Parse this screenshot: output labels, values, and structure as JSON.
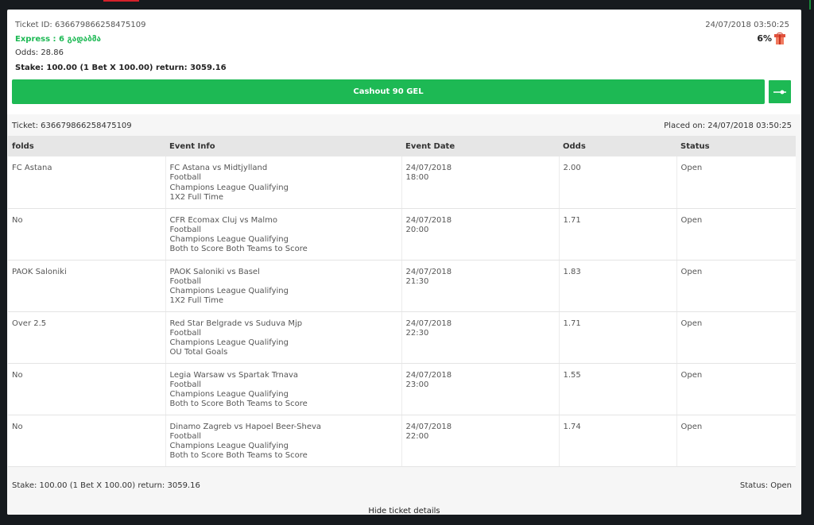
{
  "ticket": {
    "id_label": "Ticket ID: 636679866258475109",
    "date": "24/07/2018 03:50:25",
    "express": "Express : 6 გადაბმა",
    "odds": "Odds: 28.86",
    "bonus_percent": "6%",
    "stake_summary": "Stake: 100.00 (1 Bet X 100.00)  return: 3059.16"
  },
  "cashout": {
    "label": "Cashout 90 GEL"
  },
  "details": {
    "ticket_label": "Ticket: 636679866258475109",
    "placed_on": "Placed on: 24/07/2018 03:50:25",
    "columns": [
      "folds",
      "Event Info",
      "Event Date",
      "Odds",
      "Status"
    ],
    "rows": [
      {
        "fold": "FC Astana",
        "event": "FC Astana vs Midtjylland",
        "sport": "Football",
        "league": "Champions League Qualifying",
        "market": "1X2 Full Time",
        "date": "24/07/2018",
        "time": "18:00",
        "odds": "2.00",
        "status": "Open"
      },
      {
        "fold": "No",
        "event": "CFR Ecomax Cluj vs Malmo",
        "sport": "Football",
        "league": "Champions League Qualifying",
        "market": "Both to Score Both Teams to Score",
        "date": "24/07/2018",
        "time": "20:00",
        "odds": "1.71",
        "status": "Open"
      },
      {
        "fold": "PAOK Saloniki",
        "event": "PAOK Saloniki vs Basel",
        "sport": "Football",
        "league": "Champions League Qualifying",
        "market": "1X2 Full Time",
        "date": "24/07/2018",
        "time": "21:30",
        "odds": "1.83",
        "status": "Open"
      },
      {
        "fold": "Over 2.5",
        "event": "Red Star Belgrade vs Suduva Mjp",
        "sport": "Football",
        "league": "Champions League Qualifying",
        "market": "OU Total Goals",
        "date": "24/07/2018",
        "time": "22:30",
        "odds": "1.71",
        "status": "Open"
      },
      {
        "fold": "No",
        "event": "Legia Warsaw vs Spartak Trnava",
        "sport": "Football",
        "league": "Champions League Qualifying",
        "market": "Both to Score Both Teams to Score",
        "date": "24/07/2018",
        "time": "23:00",
        "odds": "1.55",
        "status": "Open"
      },
      {
        "fold": "No",
        "event": "Dinamo Zagreb vs Hapoel Beer-Sheva",
        "sport": "Football",
        "league": "Champions League Qualifying",
        "market": "Both to Score Both Teams to Score",
        "date": "24/07/2018",
        "time": "22:00",
        "odds": "1.74",
        "status": "Open"
      }
    ],
    "footer_stake": "Stake: 100.00 (1 Bet X 100.00) return: 3059.16",
    "footer_status": "Status:  Open",
    "hide_label": "Hide ticket details"
  },
  "colors": {
    "accent": "#1db954",
    "header_bg": "#e6e6e6",
    "panel_bg": "#f6f6f6",
    "page_bg": "#161a1e"
  },
  "icons": {
    "bonus": "gift-icon",
    "cashout_slider": "slider-icon"
  }
}
